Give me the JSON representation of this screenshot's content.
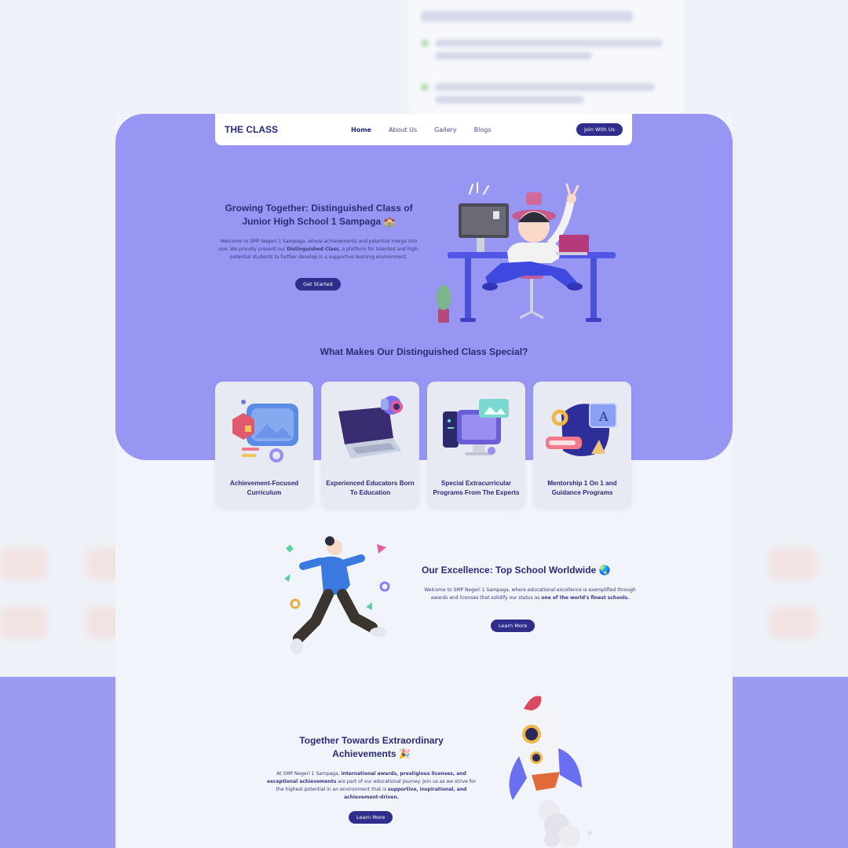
{
  "brand": {
    "logo": "THE CLASS"
  },
  "nav": {
    "links": [
      "Home",
      "About Us",
      "Gallery",
      "Blogs"
    ],
    "active": "Home",
    "cta": "Join With Us"
  },
  "hero": {
    "title": "Growing Together: Distinguished Class of Junior High School 1 Sampaga 🏫",
    "desc_1": "Welcome to SMP Negeri 1 Sampaga, where achievements and potential merge into one. We proudly present our ",
    "desc_bold": "Distinguished Class",
    "desc_2": ", a platform for talented and high-potential students to further develop in a supportive learning environment.",
    "button": "Get Started"
  },
  "features": {
    "title": "What Makes Our Distinguished Class Special?",
    "cards": [
      {
        "label": "Achievement-Focused Curriculum",
        "icon": "gallery-stack-icon"
      },
      {
        "label": "Experienced Educators Born To Education",
        "icon": "laptop-icon"
      },
      {
        "label": "Special Extracurricular Programs From The Experts",
        "icon": "desktop-computer-icon"
      },
      {
        "label": "Mentorship 1 On 1 and Guidance Programs",
        "icon": "letter-tiles-icon"
      }
    ]
  },
  "excellence": {
    "title": "Our Excellence: Top School Worldwide 🌏",
    "desc_1": "Welcome to SMP Negeri 1 Sampaga, where educational excellence is exemplified through awards and licenses that solidify our status as ",
    "desc_bold": "one of the world's finest schools.",
    "button": "Learn More"
  },
  "achievements": {
    "title": "Together Towards Extraordinary Achievements 🎉",
    "desc_1": "At SMP Negeri 1 Sampaga, ",
    "desc_bold_1": "international awards, prestigious licenses, and exceptional achievements",
    "desc_2": " are part of our educational journey. Join us as we strive for the highest potential in an environment that is ",
    "desc_bold_2": "supportive, inspirational, and achievement-driven.",
    "button": "Learn More"
  },
  "colors": {
    "hero_bg": "#9796f3",
    "primary": "#2f2e8c",
    "page_bg": "#f1f4fa",
    "heading": "#2a2c77"
  }
}
